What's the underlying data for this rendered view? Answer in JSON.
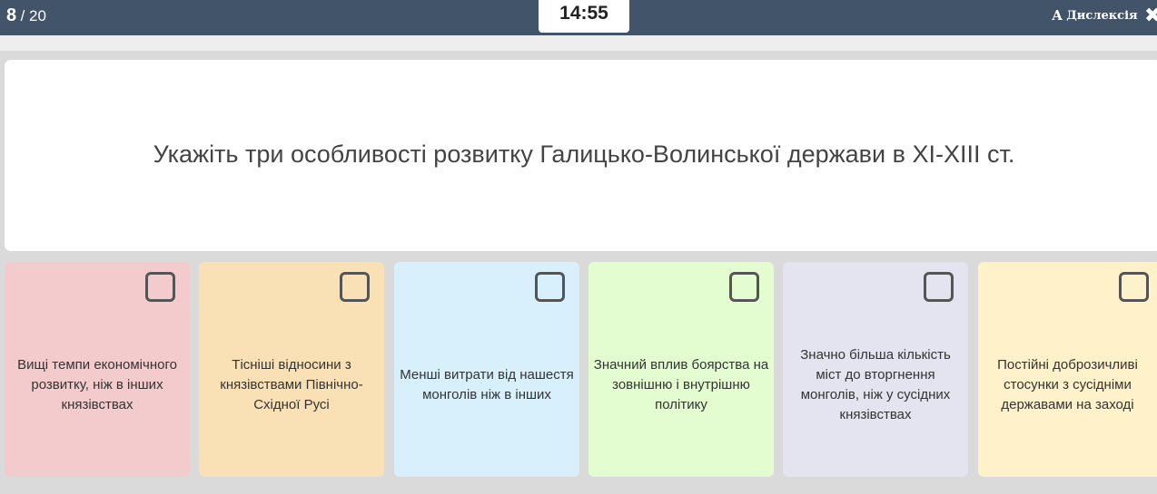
{
  "header": {
    "current_question": "8",
    "total_questions": "/ 20",
    "timer": "14:55",
    "dyslexia_icon": "А",
    "dyslexia_label": "Дислексія",
    "close_icon": "✖"
  },
  "question": {
    "text": "Укажіть три особливості розвитку Галицько-Волинської держави в XI-XIII ст."
  },
  "options": [
    {
      "label": "Вищі темпи економічного розвитку, ніж в інших князівствах",
      "color": "#f3cbcc"
    },
    {
      "label": "Тісніші відносини з князівствами Північно-Східної Русі",
      "color": "#f9e1b5"
    },
    {
      "label": "Менші витрати від нашестя монголів ніж в інших",
      "color": "#d8f0fb"
    },
    {
      "label": "Значний вплив боярства на зовнішню і внутрішню політику",
      "color": "#e3fdd1"
    },
    {
      "label": "Значно більша кількість міст до вторгнення монголів, ніж у сусідних князівствах",
      "color": "#e4e3f0"
    },
    {
      "label": "Постійні доброзичливі стосунки з сусідніми державами на заході",
      "color": "#fff1c9"
    }
  ],
  "colors": {
    "topbar": "#415469",
    "background": "#dadada"
  }
}
